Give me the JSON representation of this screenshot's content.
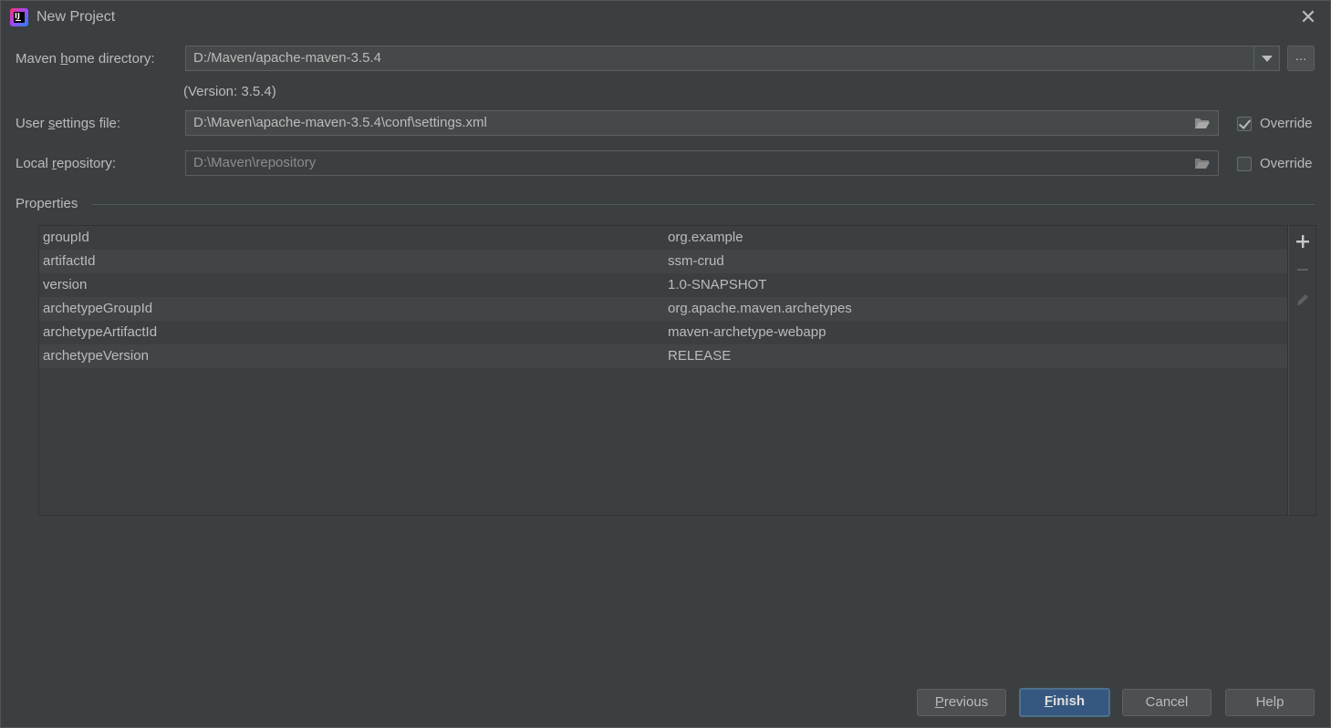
{
  "window": {
    "title": "New Project"
  },
  "form": {
    "maven_home": {
      "label_pre": "Maven ",
      "label_mn": "h",
      "label_post": "ome directory:",
      "value": "D:/Maven/apache-maven-3.5.4",
      "version_note": "(Version: 3.5.4)",
      "browse_label": "..."
    },
    "user_settings": {
      "label_pre": "User ",
      "label_mn": "s",
      "label_post": "ettings file:",
      "value": "D:\\Maven\\apache-maven-3.5.4\\conf\\settings.xml",
      "override_label": "Override",
      "override_checked": true
    },
    "local_repo": {
      "label_pre": "Local ",
      "label_mn": "r",
      "label_post": "epository:",
      "value": "D:\\Maven\\repository",
      "override_label": "Override",
      "override_checked": false
    }
  },
  "properties": {
    "title": "Properties",
    "rows": [
      {
        "key": "groupId",
        "value": "org.example"
      },
      {
        "key": "artifactId",
        "value": "ssm-crud"
      },
      {
        "key": "version",
        "value": "1.0-SNAPSHOT"
      },
      {
        "key": "archetypeGroupId",
        "value": "org.apache.maven.archetypes"
      },
      {
        "key": "archetypeArtifactId",
        "value": "maven-archetype-webapp"
      },
      {
        "key": "archetypeVersion",
        "value": "RELEASE"
      }
    ],
    "toolbar": [
      "add-icon",
      "remove-icon",
      "edit-icon"
    ]
  },
  "buttons": {
    "previous": {
      "mn": "P",
      "rest": "revious"
    },
    "finish": {
      "mn": "F",
      "rest": "inish"
    },
    "cancel": "Cancel",
    "help": "Help"
  },
  "colors": {
    "background": "#3c3f41",
    "text": "#bbbbbb",
    "field_bg": "#45494a",
    "primary_button": "#365880"
  }
}
